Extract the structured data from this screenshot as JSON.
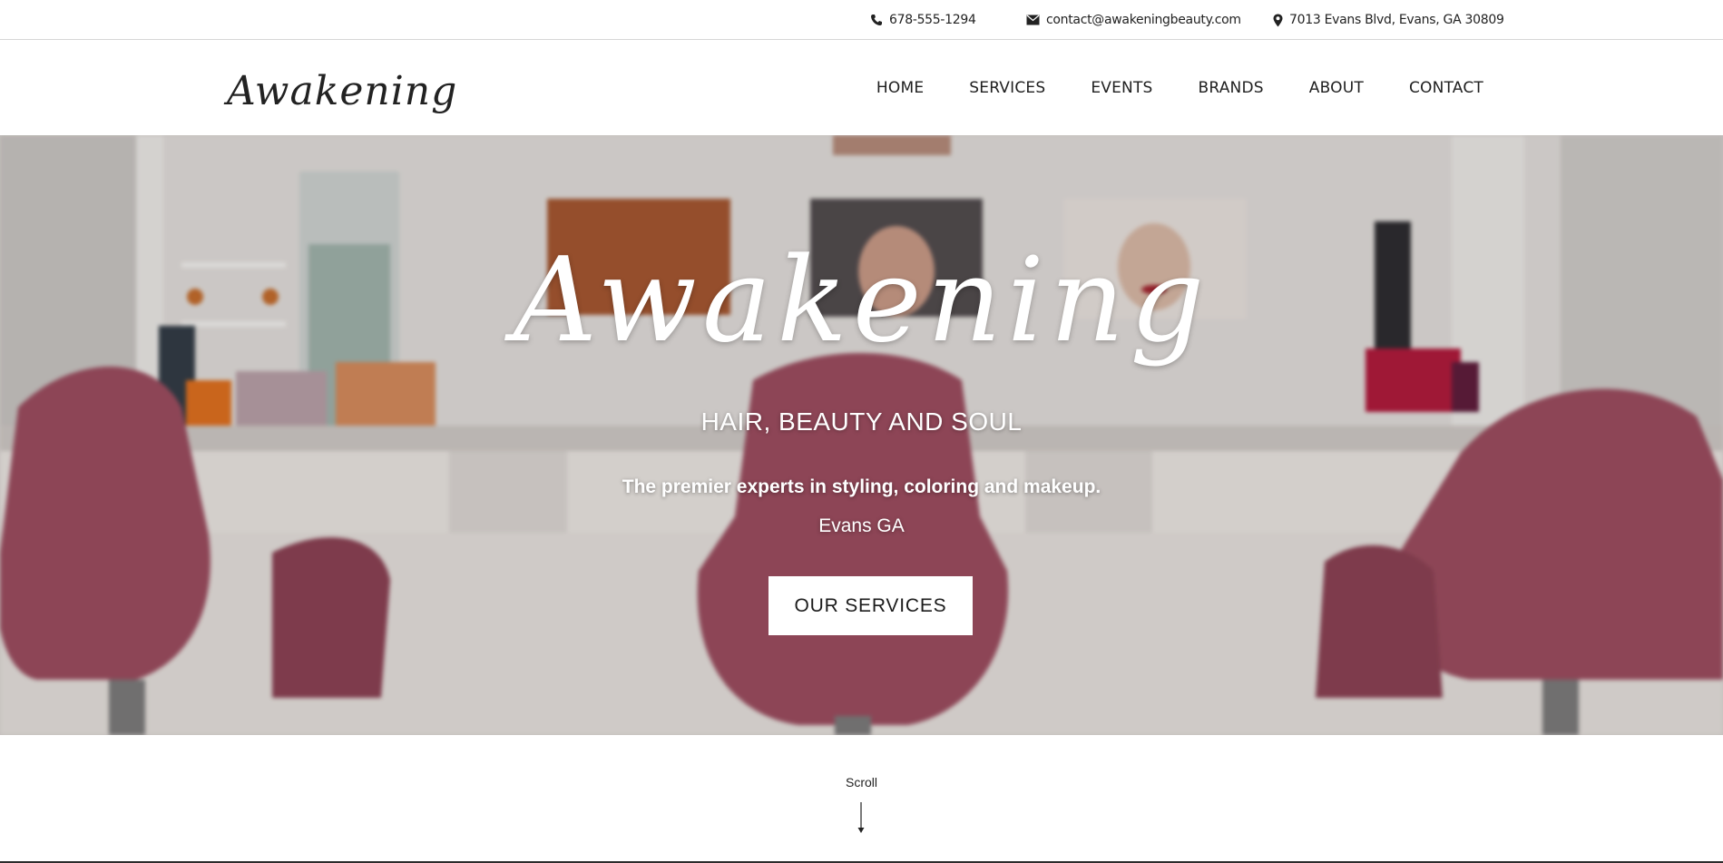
{
  "topbar": {
    "phone": "678-555-1294",
    "email": "contact@awakeningbeauty.com",
    "address": "7013 Evans Blvd, Evans, GA 30809",
    "icons": [
      "phone-icon",
      "envelope-icon",
      "map-pin-icon"
    ]
  },
  "header": {
    "logo": "Awakening",
    "nav": [
      "HOME",
      "SERVICES",
      "EVENTS",
      "BRANDS",
      "ABOUT",
      "CONTACT"
    ]
  },
  "hero": {
    "script_title": "Awakening",
    "subtitle": "HAIR, BEAUTY AND SOUL",
    "tagline": "The premier experts in styling, coloring and makeup.",
    "location": "Evans GA",
    "cta_label": "OUR SERVICES"
  },
  "scroll": {
    "label": "Scroll",
    "icon": "arrow-down-icon"
  },
  "colors": {
    "text": "#1a1a1a",
    "chair": "#9b4b5e",
    "cta_bg": "#ffffff",
    "divider": "#d6d6d6"
  }
}
